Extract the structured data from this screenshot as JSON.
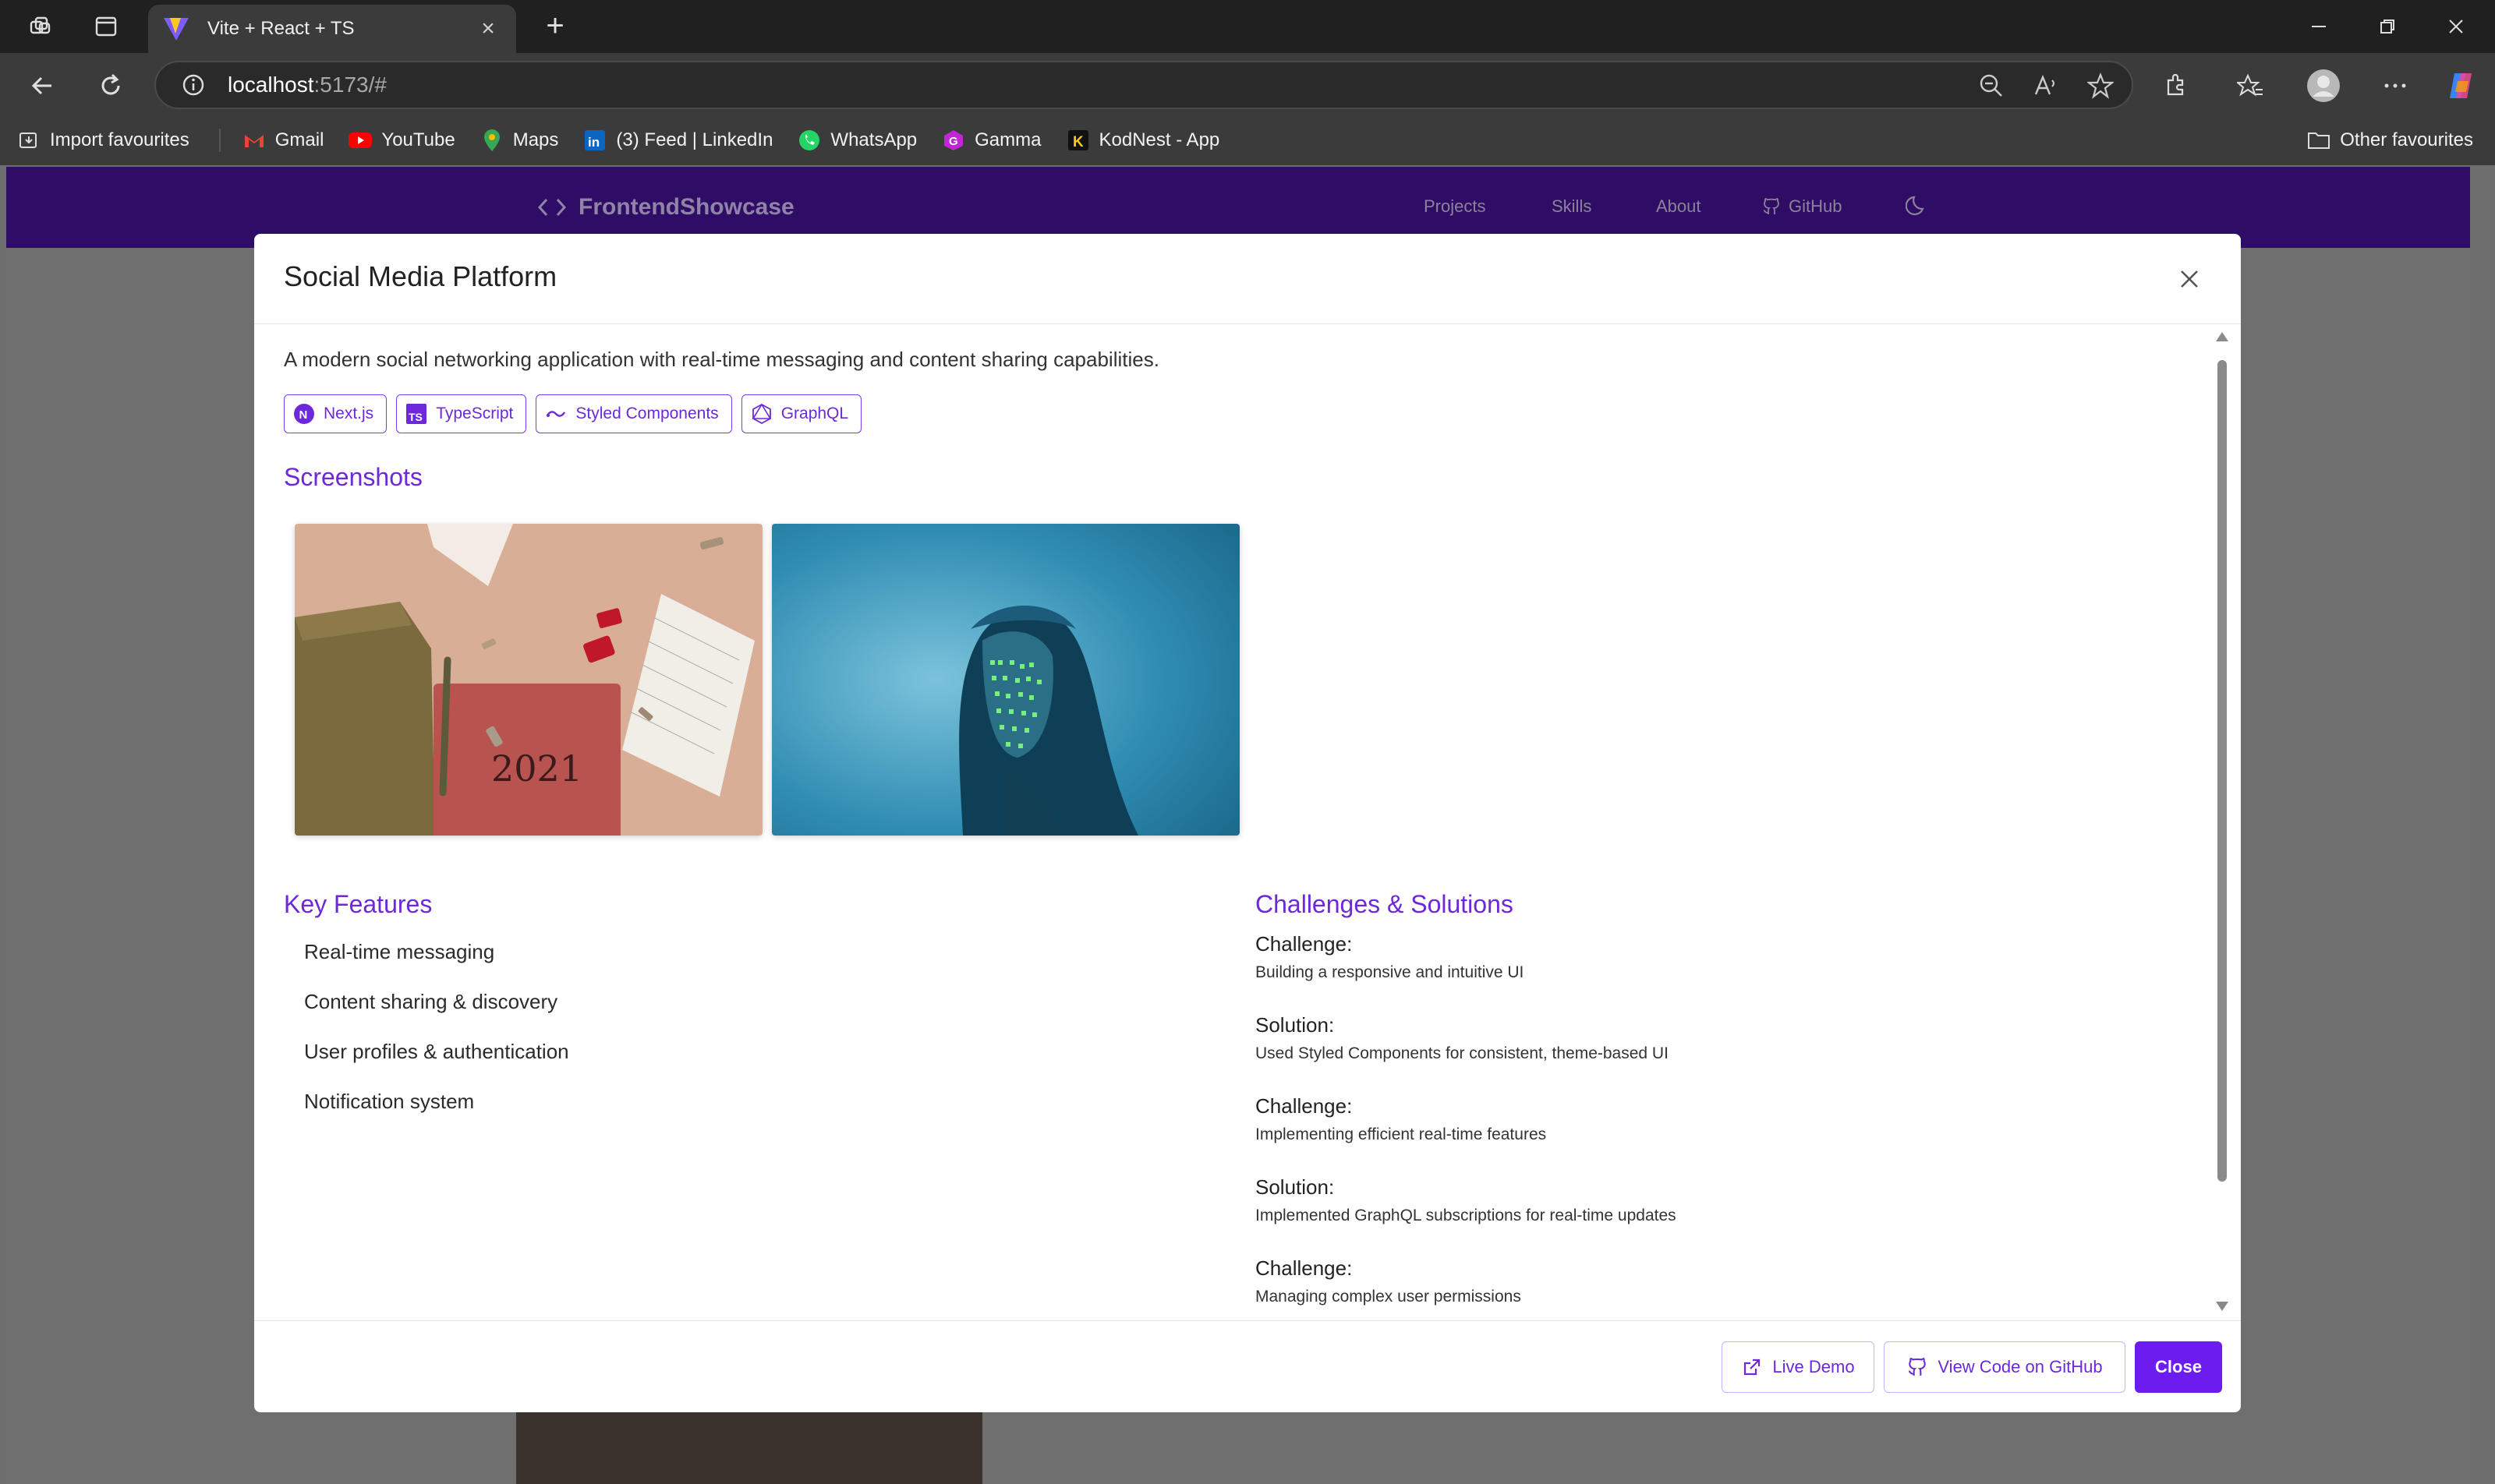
{
  "browser": {
    "tab_title": "Vite + React + TS",
    "url_host": "localhost",
    "url_rest": ":5173/#",
    "bookmarks": [
      "Import favourites",
      "Gmail",
      "YouTube",
      "Maps",
      "(3) Feed | LinkedIn",
      "WhatsApp",
      "Gamma",
      "KodNest - App"
    ],
    "other_favourites": "Other favourites"
  },
  "app": {
    "logo": "FrontendShowcase",
    "nav": [
      "Projects",
      "Skills",
      "About",
      "GitHub"
    ]
  },
  "modal": {
    "title": "Social Media Platform",
    "description": "A modern social networking application with real-time messaging and content sharing capabilities.",
    "technologies": [
      "Next.js",
      "TypeScript",
      "Styled Components",
      "GraphQL"
    ],
    "screenshots_heading": "Screenshots",
    "screenshots": [
      {
        "alt": "notebook-2021-desk-photo",
        "year_text": "2021"
      },
      {
        "alt": "code-projected-face-photo"
      }
    ],
    "features_heading": "Key Features",
    "features": [
      "Real-time messaging",
      "Content sharing & discovery",
      "User profiles & authentication",
      "Notification system"
    ],
    "challenges_heading": "Challenges & Solutions",
    "challenges": [
      {
        "label": "Challenge:",
        "text": "Building a responsive and intuitive UI"
      },
      {
        "label": "Solution:",
        "text": "Used Styled Components for consistent, theme-based UI"
      },
      {
        "label": "Challenge:",
        "text": "Implementing efficient real-time features"
      },
      {
        "label": "Solution:",
        "text": "Implemented GraphQL subscriptions for real-time updates"
      },
      {
        "label": "Challenge:",
        "text": "Managing complex user permissions"
      }
    ],
    "buttons": {
      "live_demo": "Live Demo",
      "github": "View Code on GitHub",
      "close": "Close"
    }
  },
  "colors": {
    "accent": "#6d28d9",
    "header": "#2f0d66",
    "primary_button": "#6d1cf0"
  }
}
